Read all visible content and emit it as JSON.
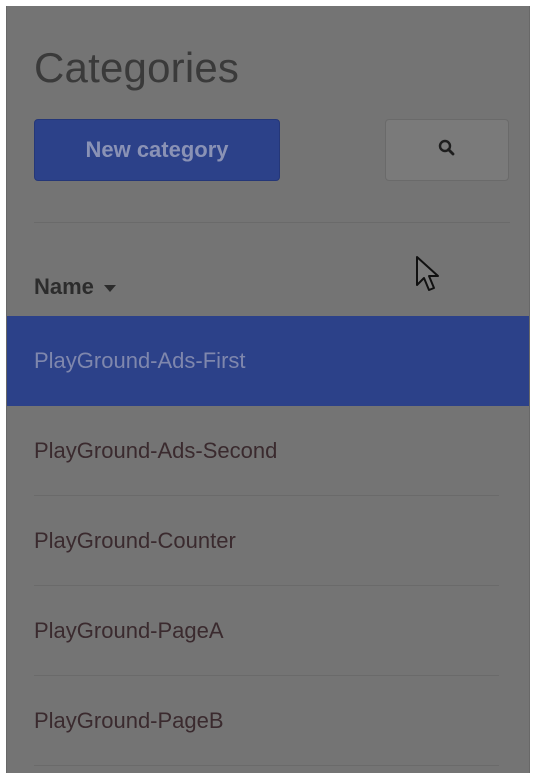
{
  "header": {
    "title": "Categories",
    "new_button_label": "New category",
    "search_icon": "search-icon"
  },
  "table": {
    "column_name": "Name",
    "sort_icon": "caret-down-icon",
    "rows": [
      {
        "label": "PlayGround-Ads-First",
        "selected": true
      },
      {
        "label": "PlayGround-Ads-Second",
        "selected": false
      },
      {
        "label": "PlayGround-Counter",
        "selected": false
      },
      {
        "label": "PlayGround-PageA",
        "selected": false
      },
      {
        "label": "PlayGround-PageB",
        "selected": false
      }
    ]
  },
  "colors": {
    "accent": "#2c4189",
    "overlay_bg": "#747474"
  }
}
